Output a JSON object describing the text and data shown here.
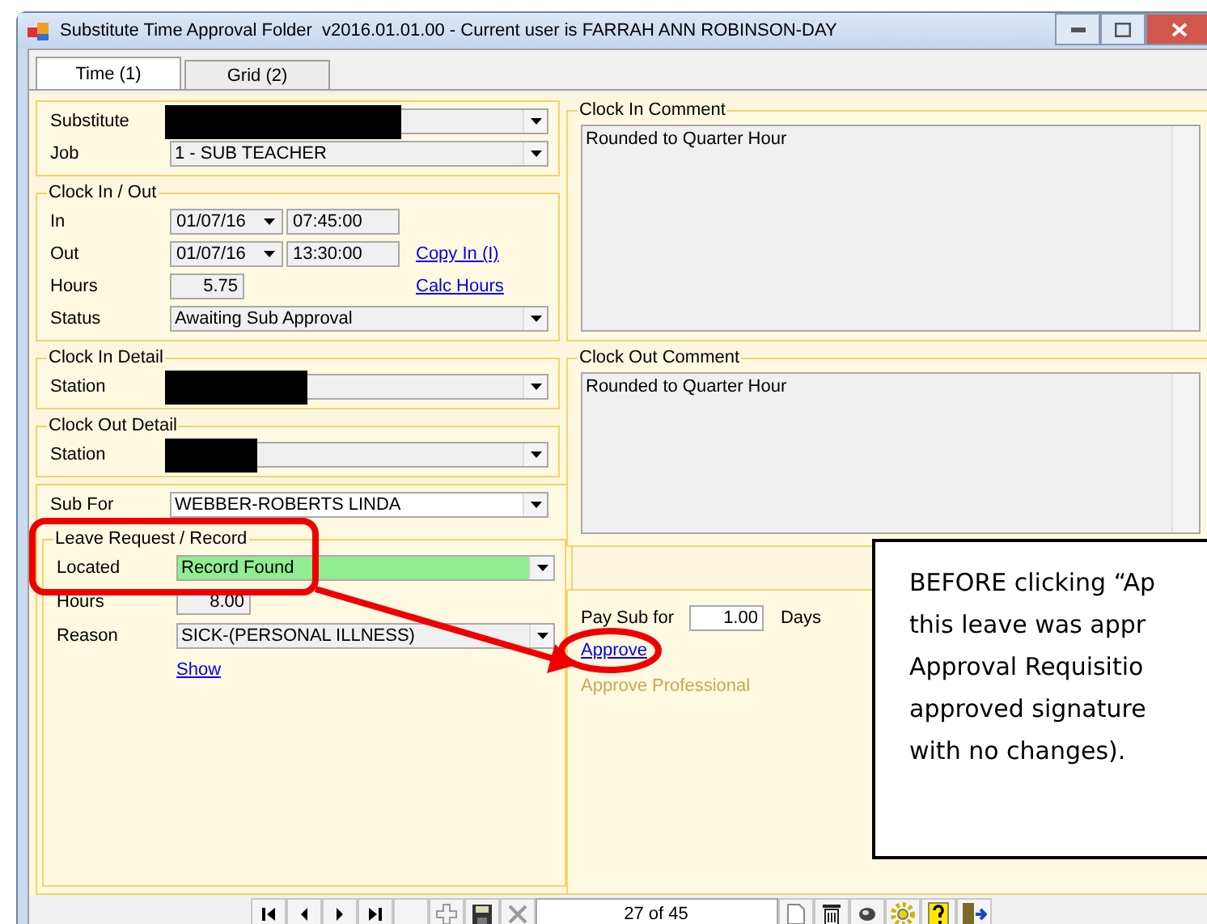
{
  "window": {
    "title": "Substitute Time Approval Folder  v2016.01.01.00 - Current user is FARRAH ANN ROBINSON-DAY"
  },
  "tabs": [
    {
      "label": "Time (1)",
      "selected": true
    },
    {
      "label": "Grid (2)",
      "selected": false
    }
  ],
  "left_groups": [
    {
      "rows": [
        {
          "label": "Substitute",
          "kind": "combo",
          "redacted": true,
          "read_only": true
        },
        {
          "label": "Job",
          "kind": "combo",
          "value": "1 - SUB TEACHER",
          "read_only": true
        }
      ]
    },
    {
      "title": "Clock In / Out",
      "rows": [
        {
          "label": "In",
          "kind": "datetime",
          "date": "01/07/16",
          "time": "07:45:00"
        },
        {
          "label": "Out",
          "kind": "datetime",
          "date": "01/07/16",
          "time": "13:30:00",
          "link": "Copy In (I)"
        },
        {
          "label": "Hours",
          "kind": "number",
          "value": "5.75",
          "link": "Calc Hours"
        },
        {
          "label": "Status",
          "kind": "combo",
          "value": "Awaiting Sub Approval",
          "read_only": true
        }
      ]
    },
    {
      "title": "Clock In Detail",
      "rows": [
        {
          "label": "Station",
          "kind": "combo",
          "redacted": true,
          "read_only": true
        }
      ]
    },
    {
      "title": "Clock Out Detail",
      "rows": [
        {
          "label": "Station",
          "kind": "combo",
          "redacted": true,
          "read_only": true
        }
      ]
    },
    {
      "rows": [
        {
          "label": "Sub For",
          "kind": "combo",
          "value": "WEBBER-ROBERTS LINDA",
          "read_only": false
        }
      ],
      "subgroup": {
        "title": "Leave Request / Record",
        "rows": [
          {
            "label": "Located",
            "kind": "combo",
            "value": "Record Found",
            "read_only": true,
            "highlighted": true
          },
          {
            "label": "Hours",
            "kind": "number",
            "value": "8.00"
          },
          {
            "label": "Reason",
            "kind": "combo",
            "value": "SICK-(PERSONAL ILLNESS)",
            "read_only": true
          },
          {
            "kind": "link",
            "link": "Show"
          }
        ]
      }
    }
  ],
  "comments": [
    {
      "title": "Clock In Comment",
      "text": "Rounded to Quarter Hour"
    },
    {
      "title": "Clock Out Comment",
      "text": "Rounded to Quarter Hour"
    }
  ],
  "pay": {
    "label": "Pay Sub for",
    "value": "1.00",
    "unit": "Days",
    "links": [
      {
        "label": "Approve",
        "disabled": false
      },
      {
        "label": "Approve Professional",
        "disabled": true
      }
    ]
  },
  "toolbar": [
    {
      "kind": "first"
    },
    {
      "kind": "prev"
    },
    {
      "kind": "next"
    },
    {
      "kind": "last"
    },
    {
      "kind": "blank"
    },
    {
      "kind": "add",
      "disabled": true
    },
    {
      "kind": "save",
      "disabled": false
    },
    {
      "kind": "delete",
      "disabled": true
    },
    {
      "kind": "counter",
      "text": "27 of 45"
    },
    {
      "kind": "new"
    },
    {
      "kind": "trash"
    },
    {
      "kind": "erase"
    },
    {
      "kind": "gear"
    },
    {
      "kind": "help"
    },
    {
      "kind": "exit"
    }
  ],
  "callout": {
    "lines": [
      "BEFORE clicking “Ap",
      "this leave was appr",
      "Approval Requisitio",
      "approved signature",
      "with no changes)."
    ]
  }
}
